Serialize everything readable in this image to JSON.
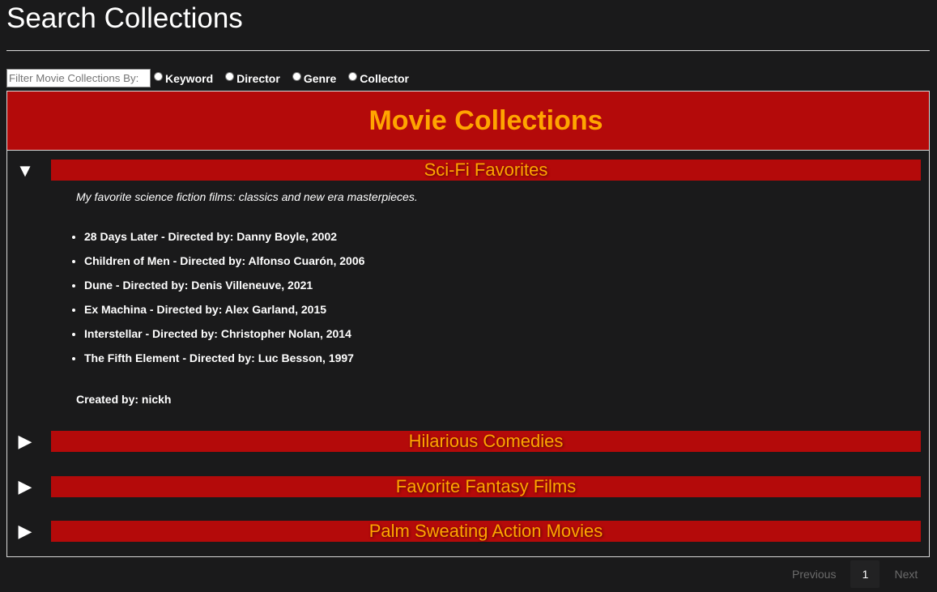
{
  "page": {
    "title": "Search Collections"
  },
  "filter": {
    "placeholder": "Filter Movie Collections By:",
    "options": [
      "Keyword",
      "Director",
      "Genre",
      "Collector"
    ]
  },
  "collections_header": "Movie Collections",
  "collections": [
    {
      "name": "Sci-Fi Favorites",
      "expanded": true,
      "toggle_glyph": "▼",
      "description": "My favorite science fiction films: classics and new era masterpieces.",
      "movies": [
        "28 Days Later - Directed by: Danny Boyle, 2002",
        "Children of Men - Directed by: Alfonso Cuarón, 2006",
        "Dune - Directed by: Denis Villeneuve, 2021",
        "Ex Machina - Directed by: Alex Garland, 2015",
        "Interstellar - Directed by: Christopher Nolan, 2014",
        "The Fifth Element - Directed by: Luc Besson, 1997"
      ],
      "created_by": "Created by: nickh"
    },
    {
      "name": "Hilarious Comedies",
      "expanded": false,
      "toggle_glyph": "▶"
    },
    {
      "name": "Favorite Fantasy Films",
      "expanded": false,
      "toggle_glyph": "▶"
    },
    {
      "name": "Palm Sweating Action Movies",
      "expanded": false,
      "toggle_glyph": "▶"
    }
  ],
  "pagination": {
    "previous": "Previous",
    "current": "1",
    "next": "Next"
  },
  "colors": {
    "background": "#1a1a1b",
    "header_bar": "#b40a0a",
    "accent_text": "#ffa500"
  }
}
